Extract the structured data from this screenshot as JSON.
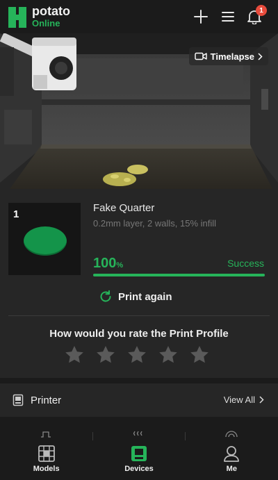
{
  "header": {
    "brand_name": "potato",
    "status": "Online",
    "notification_count": "1",
    "icons": [
      "add-icon",
      "menu-icon",
      "bell-icon"
    ]
  },
  "camera": {
    "timelapse_label": "Timelapse"
  },
  "job": {
    "plate_number": "1",
    "title": "Fake Quarter",
    "subtitle": "0.2mm layer, 2 walls, 15% infill",
    "progress_value": "100",
    "progress_unit": "%",
    "progress_fraction": 1.0,
    "result": "Success",
    "print_again_label": "Print again",
    "rating_question": "How would you rate the Print Profile",
    "rating_stars_total": 5,
    "rating_stars_selected": 0
  },
  "printer_section": {
    "title": "Printer",
    "view_all_label": "View All"
  },
  "nav": {
    "items": [
      {
        "label": "Models",
        "icon": "cube-icon"
      },
      {
        "label": "Devices",
        "icon": "device-icon"
      },
      {
        "label": "Me",
        "icon": "user-icon"
      }
    ],
    "active": "Devices"
  },
  "colors": {
    "accent": "#26b45a",
    "background": "#1b1b1b",
    "card": "#262626",
    "badge": "#e74b3c"
  }
}
